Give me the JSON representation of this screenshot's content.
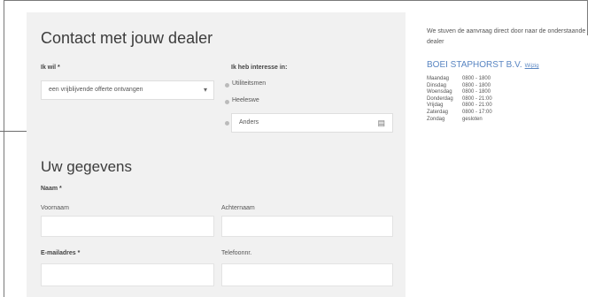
{
  "contact": {
    "title": "Contact met jouw dealer",
    "ik_wil_label": "Ik wil *",
    "ik_wil_value": "een vrijblijvende offerte ontvangen",
    "interesse_label": "Ik heb interesse in:",
    "options": [
      "Utiliteitsmen",
      "Heeleswe",
      "Anders"
    ]
  },
  "gegevens": {
    "title": "Uw gegevens",
    "naam_label": "Naam *",
    "voornaam_label": "Voornaam",
    "achternaam_label": "Achternaam",
    "email_label": "E-mailadres *",
    "telefoon_label": "Telefoonnr."
  },
  "sidebar": {
    "intro": "We stuven de aanvraag direct door naar de onderstaande dealer",
    "dealer_name": "BOEI STAPHORST B.V.",
    "dealer_link": "Wijzig",
    "hours": [
      {
        "day": "Maandag",
        "time": "0800 - 1800"
      },
      {
        "day": "Dinsdag",
        "time": "0800 - 1800"
      },
      {
        "day": "Woensdag",
        "time": "0800 - 1800"
      },
      {
        "day": "Donderdag",
        "time": "0800 - 21:00"
      },
      {
        "day": "Vrijdag",
        "time": "0800 - 21:00"
      },
      {
        "day": "Zaterdag",
        "time": "0800 - 17:00"
      },
      {
        "day": "Zondag",
        "time": "gesloten"
      }
    ]
  },
  "icons": {
    "select": "chevron-down-icon",
    "other_field": "document-icon",
    "pointer": "arrow-right-icon"
  },
  "colors": {
    "panel": "#f1f1f1",
    "dealer_accent": "#5a86c2"
  }
}
